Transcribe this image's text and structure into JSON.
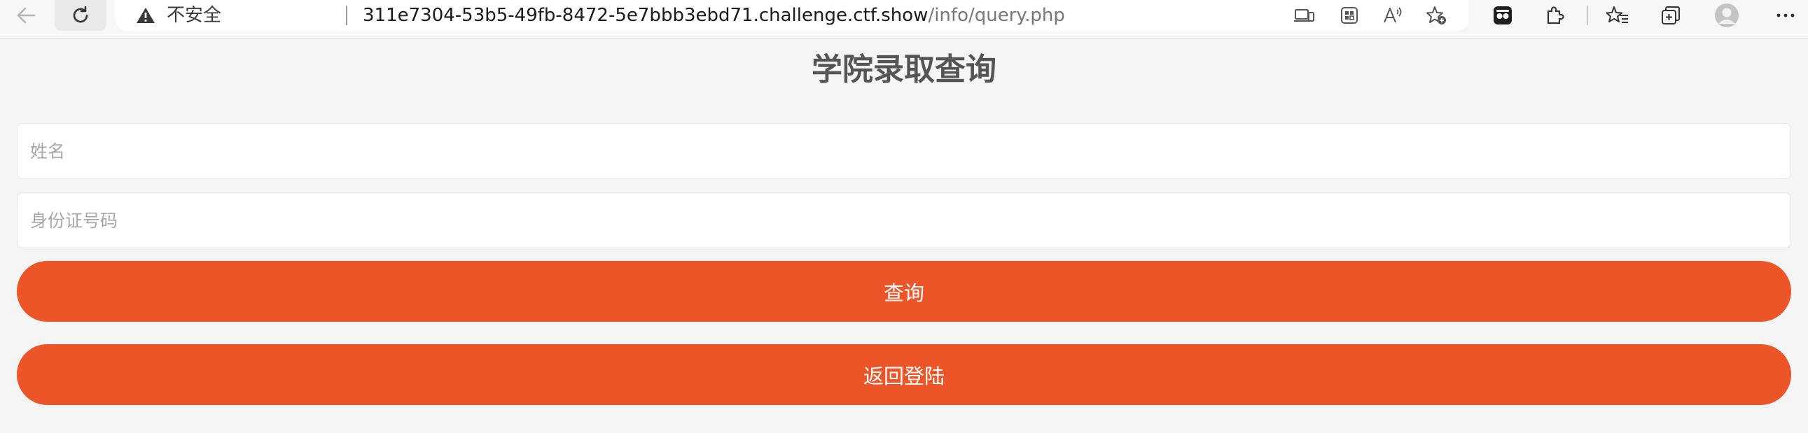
{
  "browser": {
    "security_label": "不安全",
    "url_host": "311e7304-53b5-49fb-8472-5e7bbb3ebd71.challenge.ctf.show",
    "url_path": "/info/query.php"
  },
  "page": {
    "title": "学院录取查询",
    "name_placeholder": "姓名",
    "id_placeholder": "身份证号码",
    "query_button": "查询",
    "back_button": "返回登陆"
  },
  "colors": {
    "accent": "#eb5527",
    "background": "#f5f5f5",
    "title": "#555555"
  }
}
